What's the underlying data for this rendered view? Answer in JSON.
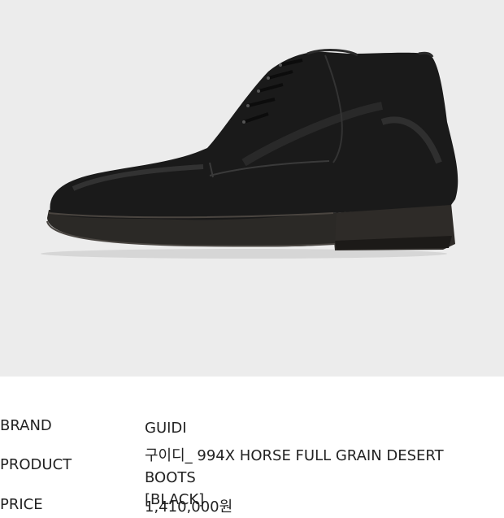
{
  "product_image": {
    "background_color": "#ececec",
    "subject": "boot-image"
  },
  "details": {
    "brand": {
      "label": "BRAND",
      "value": "GUIDI"
    },
    "product": {
      "label": "PRODUCT",
      "value_line1": "구이디_ 994X HORSE FULL GRAIN DESERT BOOTS",
      "value_line2": "[BLACK]"
    },
    "price": {
      "label": "PRICE",
      "value": "1,410,000원"
    }
  }
}
